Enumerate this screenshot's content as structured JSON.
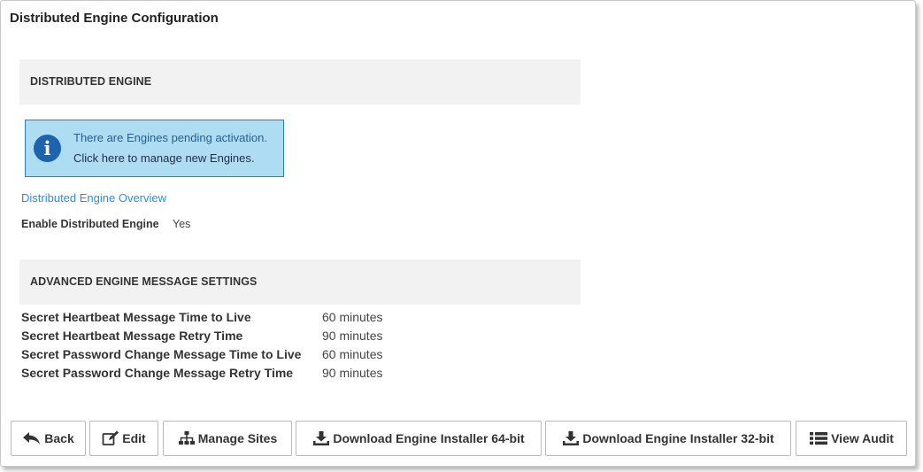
{
  "page": {
    "title": "Distributed Engine Configuration"
  },
  "distributed_engine": {
    "header": "DISTRIBUTED ENGINE",
    "info_box": {
      "icon": "info-icon",
      "line1": "There are Engines pending activation.",
      "line2": "Click here to manage new Engines."
    },
    "overview_link": "Distributed Engine Overview",
    "enable_label": "Enable Distributed Engine",
    "enable_value": "Yes"
  },
  "advanced": {
    "header": "ADVANCED ENGINE MESSAGE SETTINGS",
    "settings": [
      {
        "label": "Secret Heartbeat Message Time to Live",
        "value": "60 minutes"
      },
      {
        "label": "Secret Heartbeat Message Retry Time",
        "value": "90 minutes"
      },
      {
        "label": "Secret Password Change Message Time to Live",
        "value": "60 minutes"
      },
      {
        "label": "Secret Password Change Message Retry Time",
        "value": "90 minutes"
      }
    ]
  },
  "buttons": {
    "back": {
      "label": "Back",
      "icon": "back-arrow-icon"
    },
    "edit": {
      "label": "Edit",
      "icon": "edit-icon"
    },
    "manage_sites": {
      "label": "Manage Sites",
      "icon": "sitemap-icon"
    },
    "download_64": {
      "label": "Download Engine Installer 64-bit",
      "icon": "download-icon"
    },
    "download_32": {
      "label": "Download Engine Installer 32-bit",
      "icon": "download-icon"
    },
    "view_audit": {
      "label": "View Audit",
      "icon": "list-icon"
    }
  },
  "colors": {
    "link": "#2e8fd6",
    "info_background": "#aedcf3",
    "info_border": "#2a7fc0",
    "info_icon": "#1e63ad",
    "section_header_bg": "#f2f2f2"
  }
}
